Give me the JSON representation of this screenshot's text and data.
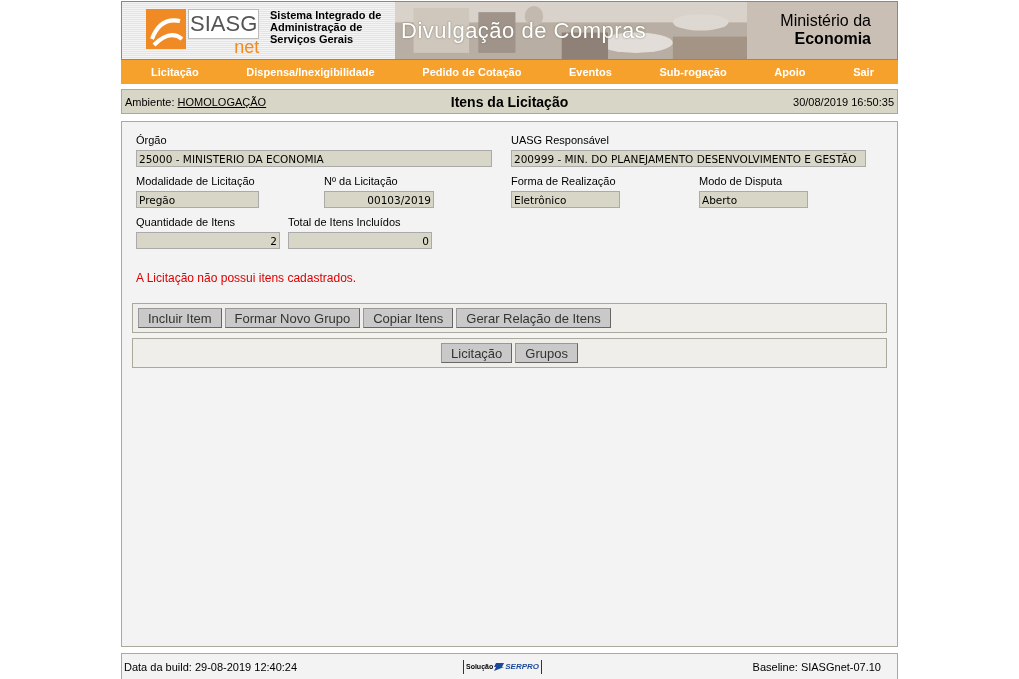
{
  "banner": {
    "logo": {
      "main": "SIASG",
      "sub": "net"
    },
    "system_name": [
      "Sistema Integrado de",
      "Administração de",
      "Serviços Gerais"
    ],
    "title": "Divulgação de Compras",
    "ministry": [
      "Ministério da",
      "Economia"
    ]
  },
  "menu": [
    "Licitação",
    "Dispensa/Inexigibilidade",
    "Pedido de Cotação",
    "Eventos",
    "Sub-rogação",
    "Apoio",
    "Sair"
  ],
  "header": {
    "environment_label": "Ambiente:",
    "environment": "HOMOLOGAÇÃO",
    "title": "Itens da Licitação",
    "datetime": "30/08/2019 16:50:35"
  },
  "form": {
    "fields": [
      {
        "label": "Órgão",
        "value": "25000 - MINISTERIO DA ECONOMIA",
        "right_aligned": false
      },
      {
        "label": "UASG Responsável",
        "value": "200999 - MIN. DO PLANEJAMENTO DESENVOLVIMENTO E GESTÃO",
        "right_aligned": false
      },
      {
        "label": "Modalidade de Licitação",
        "value": "Pregão",
        "right_aligned": false
      },
      {
        "label": "Nº da Licitação",
        "value": "00103/2019",
        "right_aligned": true
      },
      {
        "label": "Forma de Realização",
        "value": "Eletrônico",
        "right_aligned": false
      },
      {
        "label": "Modo de Disputa",
        "value": "Aberto",
        "right_aligned": false
      },
      {
        "label": "Quantidade de Itens",
        "value": "2",
        "right_aligned": true
      },
      {
        "label": "Total de Itens Incluídos",
        "value": "0",
        "right_aligned": true
      }
    ],
    "message": "A Licitação não possui itens cadastrados."
  },
  "action_buttons": [
    "Incluir Item",
    "Formar Novo Grupo",
    "Copiar Itens",
    "Gerar Relação de Itens"
  ],
  "nav_buttons": [
    "Licitação",
    "Grupos"
  ],
  "footer": {
    "build": "Data da build: 29-08-2019 12:40:24",
    "vendor_prefix": "Solução",
    "vendor": "SERPRO",
    "baseline": "Baseline: SIASGnet-07.10"
  }
}
